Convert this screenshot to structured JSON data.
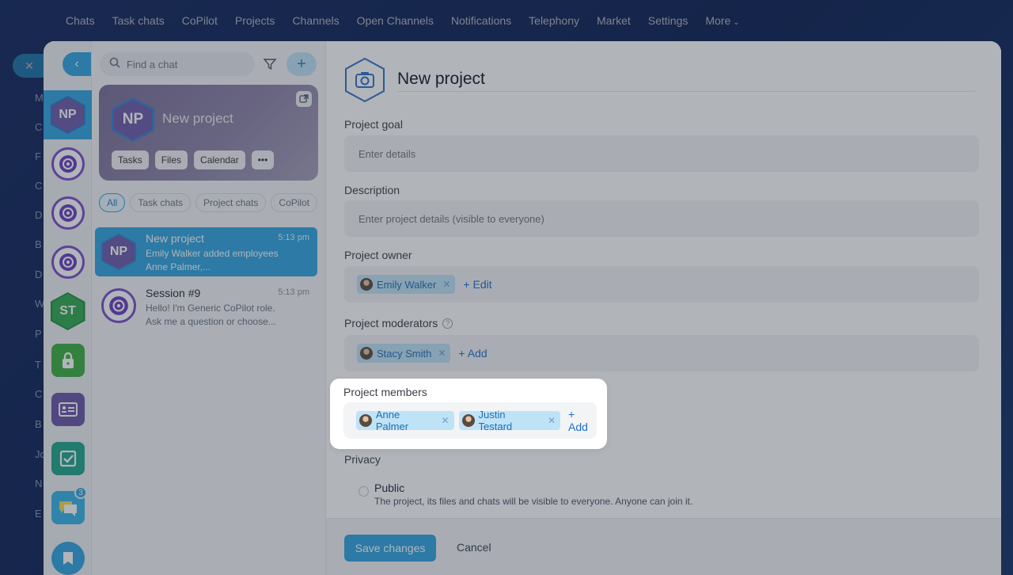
{
  "topnav": {
    "items": [
      "Chats",
      "Task chats",
      "CoPilot",
      "Projects",
      "Channels",
      "Open Channels",
      "Notifications",
      "Telephony",
      "Market",
      "Settings"
    ],
    "more_label": "More"
  },
  "background_rail": {
    "letters": [
      "M",
      "C",
      "F",
      "C",
      "D",
      "B",
      "D",
      "W",
      "P",
      "T",
      "C",
      "B",
      "Jc",
      "N",
      "E"
    ]
  },
  "search": {
    "placeholder": "Find a chat"
  },
  "rail": {
    "items": [
      {
        "type": "hex",
        "initials": "NP",
        "color": "#6c5ca8",
        "active": true
      },
      {
        "type": "copilot"
      },
      {
        "type": "copilot"
      },
      {
        "type": "copilot"
      },
      {
        "type": "hex",
        "initials": "ST",
        "color": "#2faa4f"
      },
      {
        "type": "lock",
        "color": "#3cae3f"
      },
      {
        "type": "card",
        "color": "#6a55a8"
      },
      {
        "type": "check",
        "color": "#1ea68a"
      },
      {
        "type": "chat",
        "color": "#2fa4e0",
        "badge": "3"
      },
      {
        "type": "bookmark",
        "color": "#2fa4e0"
      }
    ]
  },
  "chat_card": {
    "initials": "NP",
    "title": "New project",
    "buttons": [
      "Tasks",
      "Files",
      "Calendar"
    ]
  },
  "tabs": [
    "All",
    "Task chats",
    "Project chats",
    "CoPilot"
  ],
  "chats": [
    {
      "name": "New project",
      "time": "5:13 pm",
      "message": "Emily Walker added employees Anne Palmer,...",
      "initials": "NP"
    },
    {
      "name": "Session #9",
      "time": "5:13 pm",
      "message": "Hello! I'm Generic CoPilot role. Ask me a question or choose..."
    }
  ],
  "form": {
    "title": "New project",
    "goal": {
      "label": "Project goal",
      "placeholder": "Enter details"
    },
    "description": {
      "label": "Description",
      "placeholder": "Enter project details (visible to everyone)"
    },
    "owner": {
      "label": "Project owner",
      "tags": [
        "Emily Walker"
      ],
      "action": "+ Edit"
    },
    "moderators": {
      "label": "Project moderators",
      "tags": [
        "Stacy Smith"
      ],
      "action": "+ Add"
    },
    "members": {
      "label": "Project members",
      "tags": [
        "Anne Palmer",
        "Justin Testard"
      ],
      "action": "+ Add"
    },
    "privacy": {
      "label": "Privacy",
      "options": [
        {
          "label": "Public",
          "description": "The project, its files and chats will be visible to everyone. Anyone can join it."
        }
      ]
    }
  },
  "footer": {
    "save_label": "Save changes",
    "cancel_label": "Cancel"
  },
  "colors": {
    "accent": "#2fa4e0",
    "tag_bg": "#bfe3f6",
    "link": "#1e6fc7"
  }
}
